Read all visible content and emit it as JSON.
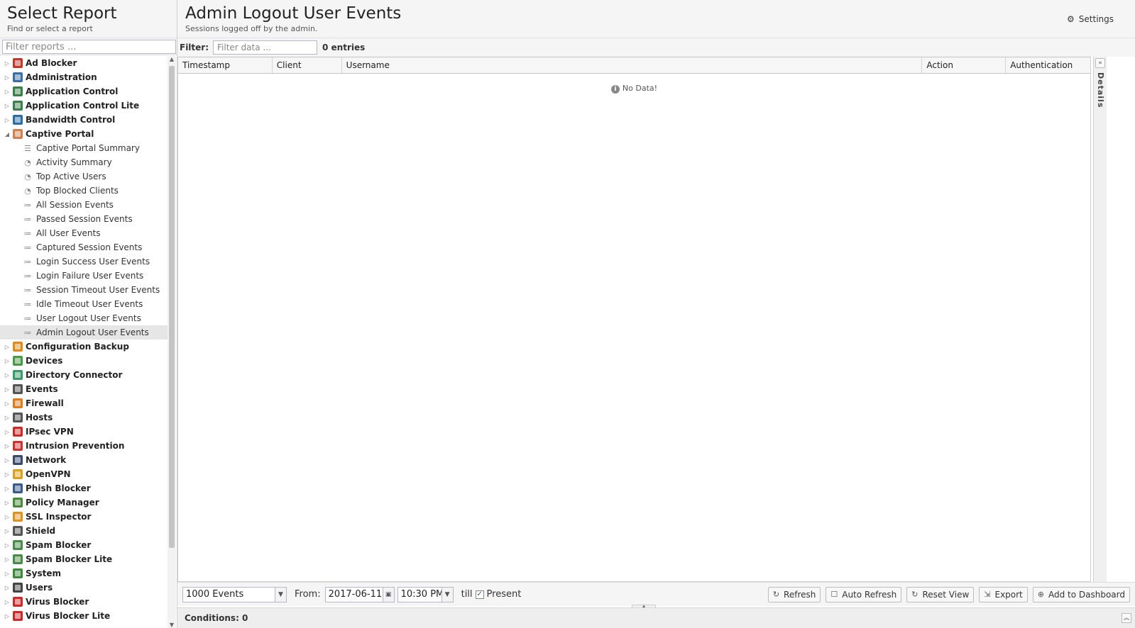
{
  "left": {
    "title": "Select Report",
    "subtitle": "Find or select a report",
    "filter_placeholder": "Filter reports ..."
  },
  "tree": [
    {
      "label": "Ad Blocker",
      "type": "cat",
      "color": "#c0392b"
    },
    {
      "label": "Administration",
      "type": "cat",
      "color": "#3a6ea5"
    },
    {
      "label": "Application Control",
      "type": "cat",
      "color": "#3a7f4a"
    },
    {
      "label": "Application Control Lite",
      "type": "cat",
      "color": "#3a7f4a"
    },
    {
      "label": "Bandwidth Control",
      "type": "cat",
      "color": "#2e6da4"
    },
    {
      "label": "Captive Portal",
      "type": "cat",
      "color": "#d08050",
      "expanded": true
    },
    {
      "label": "Captive Portal Summary",
      "type": "child",
      "icon": "text"
    },
    {
      "label": "Activity Summary",
      "type": "child",
      "icon": "pie"
    },
    {
      "label": "Top Active Users",
      "type": "child",
      "icon": "pie"
    },
    {
      "label": "Top Blocked Clients",
      "type": "child",
      "icon": "pie"
    },
    {
      "label": "All Session Events",
      "type": "child",
      "icon": "list"
    },
    {
      "label": "Passed Session Events",
      "type": "child",
      "icon": "list"
    },
    {
      "label": "All User Events",
      "type": "child",
      "icon": "list"
    },
    {
      "label": "Captured Session Events",
      "type": "child",
      "icon": "list"
    },
    {
      "label": "Login Success User Events",
      "type": "child",
      "icon": "list"
    },
    {
      "label": "Login Failure User Events",
      "type": "child",
      "icon": "list"
    },
    {
      "label": "Session Timeout User Events",
      "type": "child",
      "icon": "list"
    },
    {
      "label": "Idle Timeout User Events",
      "type": "child",
      "icon": "list"
    },
    {
      "label": "User Logout User Events",
      "type": "child",
      "icon": "list"
    },
    {
      "label": "Admin Logout User Events",
      "type": "child",
      "icon": "list",
      "selected": true
    },
    {
      "label": "Configuration Backup",
      "type": "cat",
      "color": "#e08a1e"
    },
    {
      "label": "Devices",
      "type": "cat",
      "color": "#4a9a4a"
    },
    {
      "label": "Directory Connector",
      "type": "cat",
      "color": "#3a9a6a"
    },
    {
      "label": "Events",
      "type": "cat",
      "color": "#555555"
    },
    {
      "label": "Firewall",
      "type": "cat",
      "color": "#e07a1e"
    },
    {
      "label": "Hosts",
      "type": "cat",
      "color": "#555555"
    },
    {
      "label": "IPsec VPN",
      "type": "cat",
      "color": "#cc2a2a"
    },
    {
      "label": "Intrusion Prevention",
      "type": "cat",
      "color": "#cc3333"
    },
    {
      "label": "Network",
      "type": "cat",
      "color": "#3a4a6a"
    },
    {
      "label": "OpenVPN",
      "type": "cat",
      "color": "#d9a020"
    },
    {
      "label": "Phish Blocker",
      "type": "cat",
      "color": "#3a5a8a"
    },
    {
      "label": "Policy Manager",
      "type": "cat",
      "color": "#4a8a3a"
    },
    {
      "label": "SSL Inspector",
      "type": "cat",
      "color": "#e0901e"
    },
    {
      "label": "Shield",
      "type": "cat",
      "color": "#555555"
    },
    {
      "label": "Spam Blocker",
      "type": "cat",
      "color": "#4a8a4a"
    },
    {
      "label": "Spam Blocker Lite",
      "type": "cat",
      "color": "#4a8a4a"
    },
    {
      "label": "System",
      "type": "cat",
      "color": "#3a8a3a"
    },
    {
      "label": "Users",
      "type": "cat",
      "color": "#444444"
    },
    {
      "label": "Virus Blocker",
      "type": "cat",
      "color": "#cc2a2a"
    },
    {
      "label": "Virus Blocker Lite",
      "type": "cat",
      "color": "#cc2a2a"
    }
  ],
  "main": {
    "title": "Admin Logout User Events",
    "subtitle": "Sessions logged off by the admin.",
    "settings_label": "Settings",
    "filter_label": "Filter:",
    "filter_placeholder": "Filter data ...",
    "entries": "0 entries",
    "columns": [
      "Timestamp",
      "Client",
      "Username",
      "Action",
      "Authentication"
    ],
    "no_data": "No Data!",
    "details_label": "Details"
  },
  "bottom": {
    "events_select": "1000 Events",
    "from_label": "From:",
    "from_date": "2017-06-11",
    "from_time": "10:30 PM",
    "till_label": "till",
    "present_label": "Present",
    "present_checked": true,
    "buttons": {
      "refresh": "Refresh",
      "auto_refresh": "Auto Refresh",
      "reset_view": "Reset View",
      "export": "Export",
      "add_dashboard": "Add to Dashboard"
    },
    "conditions": "Conditions: 0"
  }
}
